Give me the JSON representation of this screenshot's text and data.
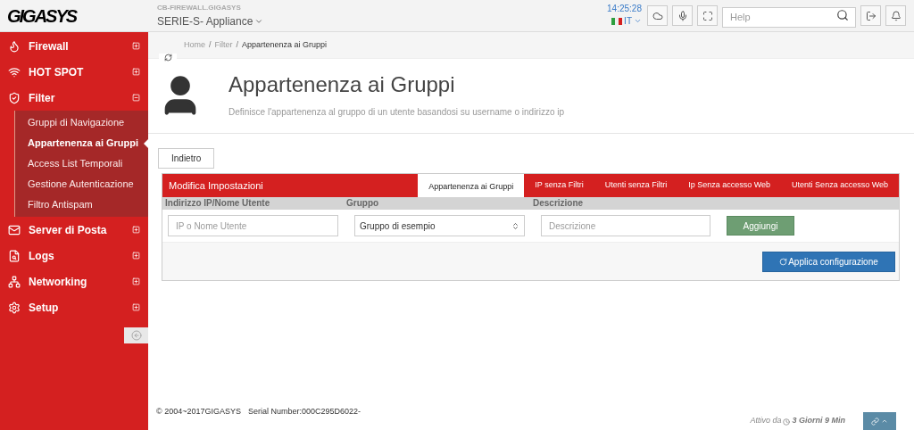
{
  "header": {
    "logo": "GIGASYS",
    "hostname": "CB-FIREWALL.GIGASYS",
    "product": "SERIE-S- Appliance",
    "clock": "14:25:28",
    "language": "IT",
    "search": {
      "placeholder": "Help"
    }
  },
  "sidebar": {
    "items": [
      {
        "label": "Firewall",
        "expanded": false
      },
      {
        "label": "HOT SPOT",
        "expanded": false
      },
      {
        "label": "Filter",
        "expanded": true,
        "children": [
          {
            "label": "Gruppi di Navigazione",
            "selected": false
          },
          {
            "label": "Appartenenza ai Gruppi",
            "selected": true
          },
          {
            "label": "Access List Temporali",
            "selected": false
          },
          {
            "label": "Gestione Autenticazione",
            "selected": false
          },
          {
            "label": "Filtro Antispam",
            "selected": false
          }
        ]
      },
      {
        "label": "Server di Posta",
        "expanded": false
      },
      {
        "label": "Logs",
        "expanded": false
      },
      {
        "label": "Networking",
        "expanded": false
      },
      {
        "label": "Setup",
        "expanded": false
      }
    ]
  },
  "breadcrumb": [
    "Home",
    "Filter",
    "Appartenenza ai Gruppi"
  ],
  "breadcrumb_separator": "/",
  "page": {
    "title": "Appartenenza ai Gruppi",
    "subtitle": "Definisce l'appartenenza al gruppo di un utente basandosi su username o indirizzo ip"
  },
  "back_button": "Indietro",
  "panel": {
    "title": "Modifica Impostazioni",
    "tabs": [
      {
        "label": "Appartenenza ai Gruppi",
        "selected": true
      },
      {
        "label": "IP senza Filtri",
        "selected": false
      },
      {
        "label": "Utenti senza Filtri",
        "selected": false
      },
      {
        "label": "Ip Senza accesso Web",
        "selected": false
      },
      {
        "label": "Utenti Senza accesso Web",
        "selected": false
      }
    ],
    "columns": [
      "Indirizzo IP/Nome Utente",
      "Gruppo",
      "Descrizione"
    ],
    "user_field": {
      "placeholder": "IP o Nome Utente"
    },
    "group_select": {
      "value": "Gruppo di esempio"
    },
    "description_field": {
      "placeholder": "Descrizione"
    },
    "add_button": "Aggiungi",
    "apply_button": "Applica configurazione"
  },
  "footer": {
    "copyright": "© 2004~2017GIGASYS",
    "serial": "Serial Number:000C295D6022-",
    "uptime_label": "Attivo da",
    "uptime": "3 Giorni 9 Min"
  }
}
